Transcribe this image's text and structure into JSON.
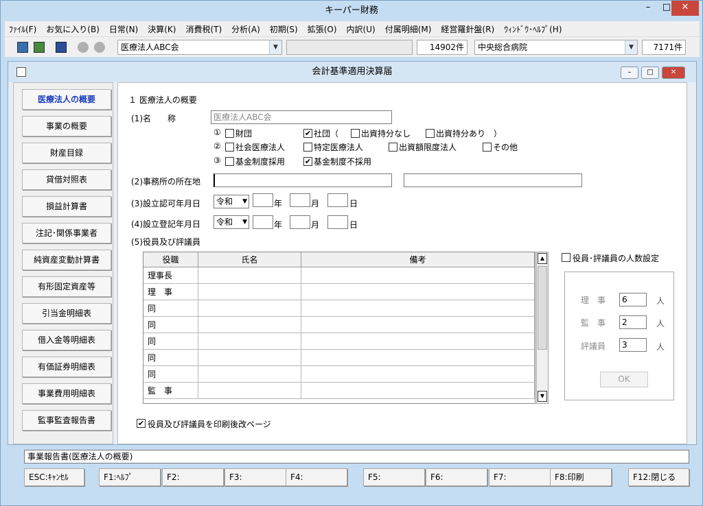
{
  "window": {
    "title": "キーパー財務",
    "minimize": "–",
    "maximize": "□",
    "close": "✕"
  },
  "menu": [
    "ﾌｧｲﾙ(F)",
    "お気に入り(B)",
    "日常(N)",
    "決算(K)",
    "消費税(T)",
    "分析(A)",
    "初期(S)",
    "拡張(O)",
    "内訳(U)",
    "付属明細(M)",
    "経営羅針盤(R)",
    "ｳｨﾝﾄﾞｳ･ﾍﾙﾌﾟ(H)"
  ],
  "toolbar": {
    "company": "医療法人ABC会",
    "count1": "14902件",
    "hospital": "中央総合病院",
    "count2": "7171件"
  },
  "child": {
    "title": "会計基準適用決算届"
  },
  "nav": [
    "医療法人の概要",
    "事業の概要",
    "財産目録",
    "貸借対照表",
    "損益計算書",
    "注記･関係事業者",
    "純資産変動計算書",
    "有形固定資産等",
    "引当金明細表",
    "借入金等明細表",
    "有価証券明細表",
    "事業費用明細表",
    "監事監査報告書"
  ],
  "form": {
    "section_title": "１ 医療法人の概要",
    "name_label": "(1)名　　称",
    "name_value": "医療法人ABC会",
    "row1_num": "①",
    "row2_num": "②",
    "row3_num": "③",
    "opt_zaidan": "財団",
    "opt_shadan": "社団（",
    "opt_nashi": "出資持分なし",
    "opt_ari": "出資持分あり　）",
    "opt_shakai": "社会医療法人",
    "opt_tokutei": "特定医療法人",
    "opt_gendo": "出資額限度法人",
    "opt_sonota": "その他",
    "opt_saiyo": "基金制度採用",
    "opt_fusaiyo": "基金制度不採用",
    "check_mark": "✔",
    "address_label": "(2)事務所の所在地",
    "ninka_label": "(3)設立認可年月日",
    "toki_label": "(4)設立登記年月日",
    "era": "令和",
    "year": "年",
    "month": "月",
    "day": "日",
    "officers_label": "(5)役員及び評議員",
    "print_label": "役員及び評議員を印刷後改ページ"
  },
  "grid": {
    "headers": [
      "役職",
      "氏名",
      "備考"
    ],
    "rows": [
      "理事長",
      "理　事",
      "同",
      "同",
      "同",
      "同",
      "同",
      "監　事"
    ]
  },
  "people": {
    "check_label": "役員･評議員の人数設定",
    "riji": "理　事",
    "riji_val": "6",
    "kanji": "監　事",
    "kanji_val": "2",
    "hyogi": "評議員",
    "hyogi_val": "3",
    "unit": "人",
    "ok": "OK"
  },
  "status": "事業報告書(医療法人の概要)",
  "fkeys": [
    "ESC:ｷｬﾝｾﾙ",
    "F1:ﾍﾙﾌﾟ",
    "F2:",
    "F3:",
    "F4:",
    "F5:",
    "F6:",
    "F7:",
    "F8:印刷",
    "F12:閉じる"
  ],
  "scroll": {
    "up": "▲",
    "down": "▼"
  },
  "dropdown": "▼"
}
